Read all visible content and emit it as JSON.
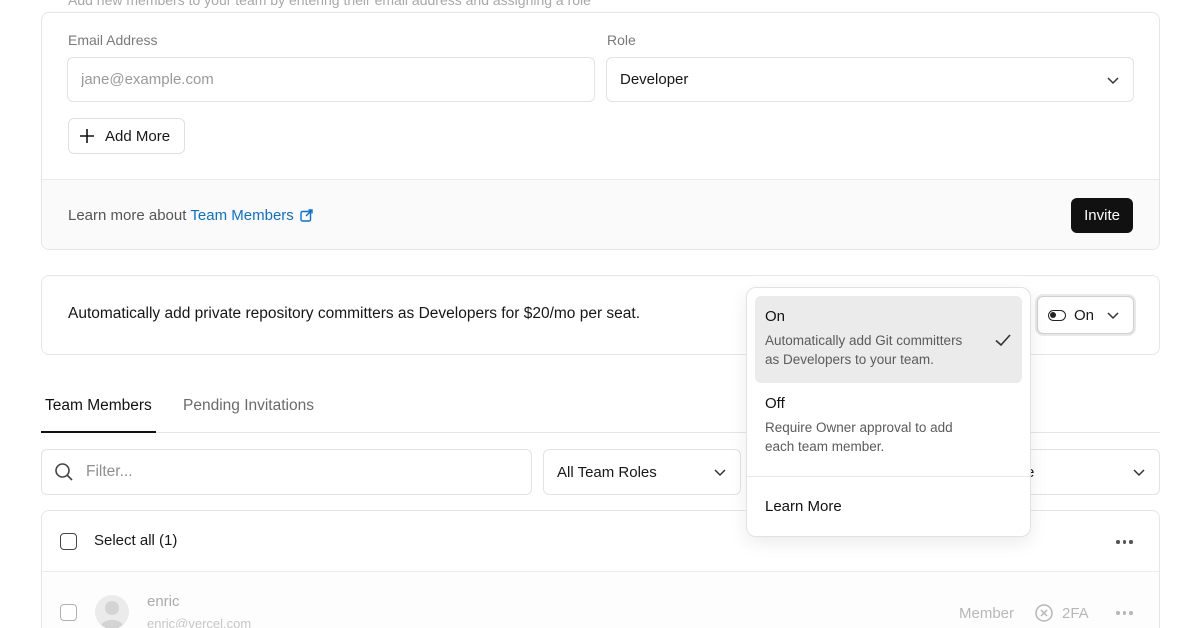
{
  "invite_section": {
    "hint": "Add new members to your team by entering their email address and assigning a role",
    "email_label": "Email Address",
    "email_placeholder": "jane@example.com",
    "role_label": "Role",
    "role_value": "Developer",
    "add_more_label": "Add More",
    "learn_prefix": "Learn more about",
    "learn_link": "Team Members",
    "invite_button": "Invite"
  },
  "auto_add": {
    "text": "Automatically add private repository committers as Developers for $20/mo per seat.",
    "toggle_value": "On"
  },
  "dropdown": {
    "options": [
      {
        "title": "On",
        "description": "Automatically add Git committers as Developers to your team."
      },
      {
        "title": "Off",
        "description": "Require Owner approval to add each team member."
      }
    ],
    "learn_more": "Learn More"
  },
  "tabs": [
    {
      "label": "Team Members"
    },
    {
      "label": "Pending Invitations"
    }
  ],
  "filters": {
    "search_placeholder": "Filter...",
    "roles_value": "All Team Roles",
    "third_value_partial": "e"
  },
  "members": {
    "select_all_label": "Select all (1)",
    "rows": [
      {
        "name": "enric",
        "email": "enric@vercel.com",
        "role": "Member",
        "twofa": "2FA"
      }
    ]
  },
  "colors": {
    "link": "#0a6fd6",
    "primary_button": "#111111",
    "selected_option_bg": "#ebebeb"
  }
}
